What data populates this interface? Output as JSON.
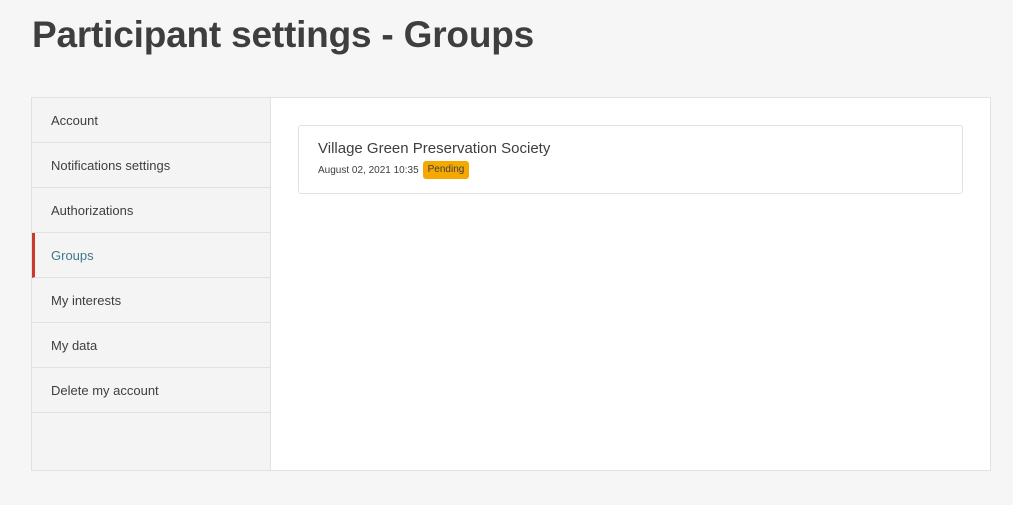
{
  "page": {
    "title": "Participant settings - Groups"
  },
  "sidebar": {
    "items": [
      {
        "label": "Account"
      },
      {
        "label": "Notifications settings"
      },
      {
        "label": "Authorizations"
      },
      {
        "label": "Groups",
        "active": true
      },
      {
        "label": "My interests"
      },
      {
        "label": "My data"
      },
      {
        "label": "Delete my account"
      }
    ]
  },
  "groups": [
    {
      "name": "Village Green Preservation Society",
      "date": "August 02, 2021 10:35",
      "status": "Pending"
    }
  ],
  "colors": {
    "accent_active_border": "#c93a2c",
    "active_link": "#3a7a8c",
    "pending_badge": "#f5a800"
  }
}
